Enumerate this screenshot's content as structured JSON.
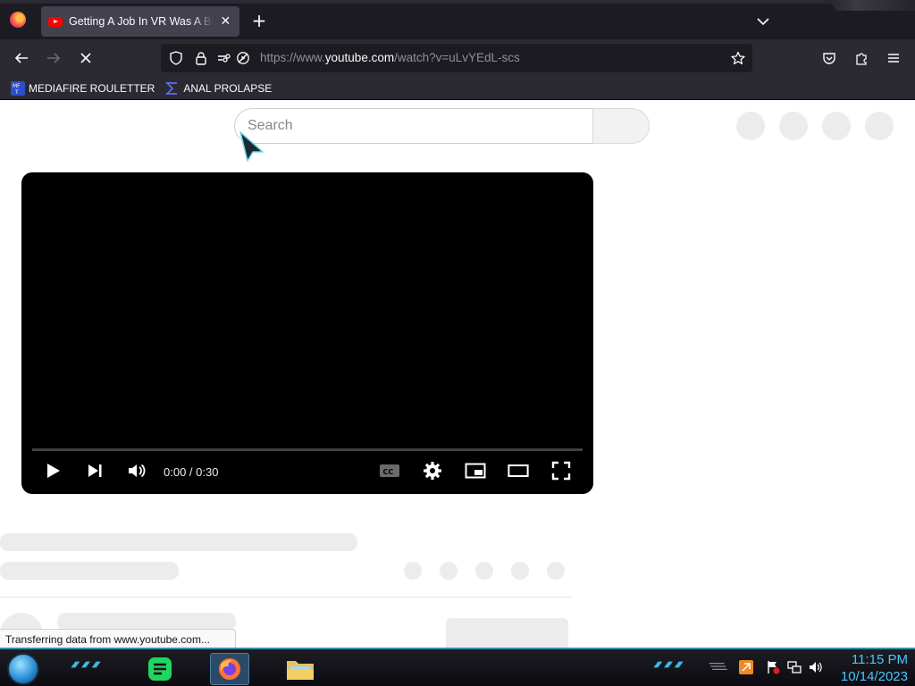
{
  "browser": {
    "tab": {
      "title": "Getting A Job In VR Was A Big M"
    },
    "url": {
      "prefix": "https://www.",
      "host": "youtube.com",
      "path": "/watch?v=uLvYEdL-scs"
    },
    "bookmarks": [
      {
        "label": "MEDIAFIRE ROULETTER",
        "icon": "mediafire-icon"
      },
      {
        "label": "ANAL PROLAPSE",
        "icon": "sigma-icon"
      }
    ],
    "status_text": "Transferring data from www.youtube.com...",
    "loading": true
  },
  "youtube": {
    "search": {
      "placeholder": "Search",
      "value": ""
    },
    "player": {
      "time": "0:00 / 0:30",
      "progress": 0,
      "captions_label": "CC"
    }
  },
  "taskbar": {
    "clock": {
      "time": "11:15 PM",
      "date": "10/14/2023"
    },
    "apps": [
      "notes-app-icon",
      "firefox-icon",
      "file-explorer-icon"
    ],
    "accent_color": "#46c8ff"
  },
  "colors": {
    "chrome_dark": "#1c1b22",
    "chrome_toolbar": "#2b2a33",
    "youtube_red": "#ff0000",
    "skeleton": "#ececec"
  }
}
